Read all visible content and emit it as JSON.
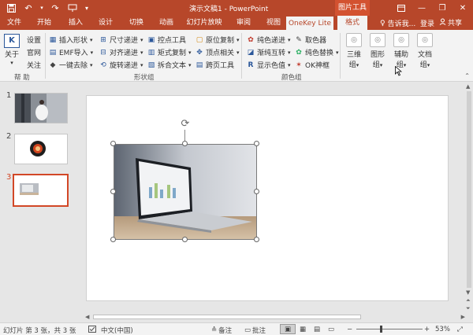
{
  "title_bar": {
    "window_title": "演示文稿1 - PowerPoint",
    "context_tool": "图片工具",
    "qat_icons": [
      "save-icon",
      "undo-icon",
      "redo-icon",
      "present-icon"
    ]
  },
  "tabs": [
    "文件",
    "开始",
    "插入",
    "设计",
    "切换",
    "动画",
    "幻灯片放映",
    "审阅",
    "视图",
    "OneKey Lite",
    "格式"
  ],
  "active_tab": "OneKey Lite",
  "tell_me": "告诉我...",
  "login": "登录",
  "share": "共享",
  "ribbon": {
    "help_group": {
      "about": "关于",
      "settings": "设置",
      "website": "官网",
      "follow": "关注",
      "label": "帮 助"
    },
    "shape_group": {
      "col1": [
        "插入形状",
        "EMF导入",
        "一键去除"
      ],
      "col2": [
        "尺寸递进",
        "对齐递进",
        "旋转递进"
      ],
      "col3": [
        "控点工具",
        "矩式复制",
        "拆合文本"
      ],
      "col4": [
        "原位复制",
        "顶点相关",
        "跨页工具"
      ],
      "label": "形状组"
    },
    "color_group": {
      "col1": [
        "纯色递进",
        "渐纯互转",
        "显示色值"
      ],
      "col2": [
        "取色器",
        "纯色替换",
        "OK神框"
      ],
      "label": "颜色组"
    },
    "big_buttons": [
      {
        "line1": "三维",
        "line2": "组"
      },
      {
        "line1": "图形",
        "line2": "组"
      },
      {
        "line1": "辅助",
        "line2": "组"
      },
      {
        "line1": "文档",
        "line2": "组"
      }
    ]
  },
  "slides": [
    {
      "number": "1"
    },
    {
      "number": "2"
    },
    {
      "number": "3"
    }
  ],
  "status": {
    "slide_info": "幻灯片 第 3 张，共 3 张",
    "language": "中文(中国)",
    "notes": "备注",
    "comments": "批注",
    "zoom": "53%"
  }
}
